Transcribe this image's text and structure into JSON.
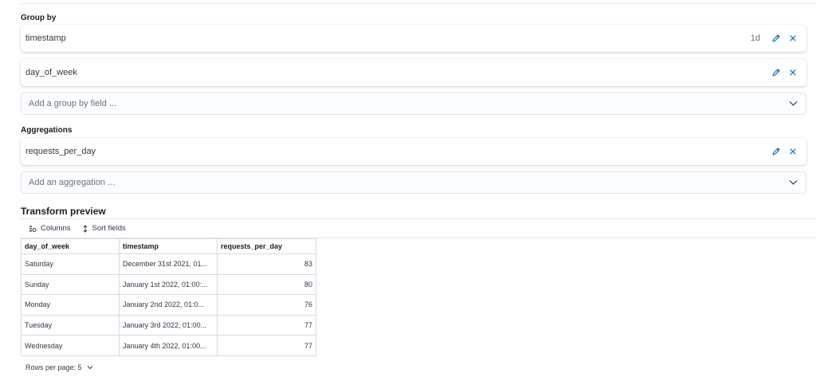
{
  "group_by": {
    "title": "Group by",
    "items": [
      {
        "label": "timestamp",
        "interval": "1d"
      },
      {
        "label": "day_of_week",
        "interval": ""
      }
    ],
    "add_placeholder": "Add a group by field ..."
  },
  "aggregations": {
    "title": "Aggregations",
    "items": [
      {
        "label": "requests_per_day"
      }
    ],
    "add_placeholder": "Add an aggregation ..."
  },
  "preview": {
    "title": "Transform preview",
    "toolbar": {
      "columns_label": "Columns",
      "sort_label": "Sort fields"
    },
    "columns": [
      "day_of_week",
      "timestamp",
      "requests_per_day"
    ],
    "rows": [
      [
        "Saturday",
        "December 31st 2021, 01...",
        "83"
      ],
      [
        "Sunday",
        "January 1st 2022, 01:00:...",
        "80"
      ],
      [
        "Monday",
        "January 2nd 2022, 01:0...",
        "76"
      ],
      [
        "Tuesday",
        "January 3rd 2022, 01:00...",
        "77"
      ],
      [
        "Wednesday",
        "January 4th 2022, 01:00...",
        "77"
      ]
    ],
    "pagination": {
      "rows_per_page_label": "Rows per page: 5"
    }
  },
  "colors": {
    "accent": "#006bb8",
    "border": "#d3dae6",
    "text": "#343741"
  }
}
